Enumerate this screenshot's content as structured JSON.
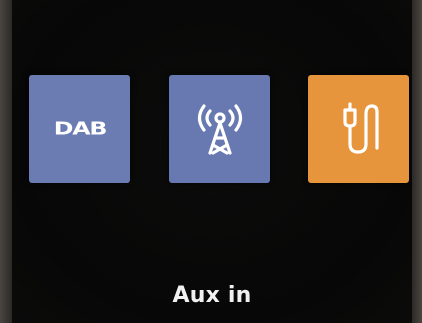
{
  "menu": {
    "items": [
      {
        "id": "dab",
        "label": "DAB",
        "icon": "dab-text-icon",
        "color": "#6a7cb2",
        "selected": false
      },
      {
        "id": "fm",
        "label": "",
        "icon": "radio-tower-icon",
        "color": "#6779b0",
        "selected": false
      },
      {
        "id": "aux",
        "label": "",
        "icon": "aux-cable-icon",
        "color": "#e6953d",
        "selected": true
      }
    ]
  },
  "selected_mode_label": "Aux in"
}
